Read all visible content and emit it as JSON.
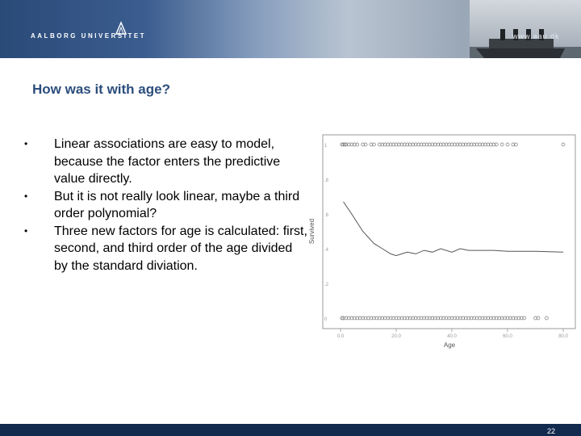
{
  "banner": {
    "university": "AALBORG UNIVERSITET",
    "url": "www.aau.dk"
  },
  "slide": {
    "title": "How was it with age?",
    "bullets": [
      "Linear associations are easy to model, because the factor enters the predictive value directly.",
      "But it is not really look linear, maybe a third order polynomial?",
      "Three new factors for age is calculated: first, second, and third order of the age divided by the standard diviation."
    ],
    "page_number": "22"
  },
  "chart_data": {
    "type": "scatter",
    "xlabel": "Age",
    "ylabel": "Survived",
    "xlim": [
      0,
      80
    ],
    "ylim": [
      0,
      1
    ],
    "x_ticks": [
      "0.0",
      "20.0",
      "40.0",
      "60.0",
      "80.0"
    ],
    "y_ticks": [
      "0",
      ".2",
      ".4",
      ".6",
      ".8",
      "1"
    ],
    "points_survived_1": [
      0.5,
      1,
      1.5,
      2,
      3,
      4,
      5,
      6,
      8,
      9,
      11,
      12,
      14,
      15,
      16,
      17,
      18,
      19,
      20,
      21,
      22,
      23,
      24,
      25,
      26,
      27,
      28,
      29,
      30,
      31,
      32,
      33,
      34,
      35,
      36,
      37,
      38,
      39,
      40,
      41,
      42,
      43,
      44,
      45,
      46,
      47,
      48,
      49,
      50,
      51,
      52,
      53,
      54,
      55,
      56,
      58,
      60,
      62,
      63,
      80
    ],
    "points_survived_0": [
      0.5,
      1,
      2,
      3,
      4,
      5,
      6,
      7,
      8,
      9,
      10,
      11,
      12,
      13,
      14,
      15,
      16,
      17,
      18,
      19,
      20,
      21,
      22,
      23,
      24,
      25,
      26,
      27,
      28,
      29,
      30,
      31,
      32,
      33,
      34,
      35,
      36,
      37,
      38,
      39,
      40,
      41,
      42,
      43,
      44,
      45,
      46,
      47,
      48,
      49,
      50,
      51,
      52,
      53,
      54,
      55,
      56,
      57,
      58,
      59,
      60,
      61,
      62,
      63,
      64,
      65,
      66,
      70,
      71,
      74
    ],
    "smooth_curve": [
      {
        "x": 1,
        "y": 0.67
      },
      {
        "x": 4,
        "y": 0.6
      },
      {
        "x": 8,
        "y": 0.5
      },
      {
        "x": 12,
        "y": 0.43
      },
      {
        "x": 15,
        "y": 0.4
      },
      {
        "x": 18,
        "y": 0.37
      },
      {
        "x": 20,
        "y": 0.36
      },
      {
        "x": 22,
        "y": 0.37
      },
      {
        "x": 24,
        "y": 0.38
      },
      {
        "x": 27,
        "y": 0.37
      },
      {
        "x": 30,
        "y": 0.39
      },
      {
        "x": 33,
        "y": 0.38
      },
      {
        "x": 36,
        "y": 0.4
      },
      {
        "x": 40,
        "y": 0.38
      },
      {
        "x": 43,
        "y": 0.4
      },
      {
        "x": 46,
        "y": 0.39
      },
      {
        "x": 50,
        "y": 0.39
      },
      {
        "x": 55,
        "y": 0.39
      },
      {
        "x": 60,
        "y": 0.385
      },
      {
        "x": 70,
        "y": 0.385
      },
      {
        "x": 80,
        "y": 0.38
      }
    ],
    "grid": false,
    "colors": {
      "points": "#777777",
      "line": "#555555",
      "axis": "#999999"
    }
  },
  "colors": {
    "title": "#2c4e7c",
    "footer": "#112a4e"
  }
}
